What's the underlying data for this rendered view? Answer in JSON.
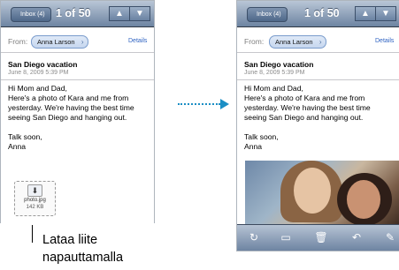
{
  "left_screen": {
    "back_label": "Inbox (4)",
    "title": "1 of 50",
    "up_arrow": "▲",
    "down_arrow": "▼",
    "from_label": "From:",
    "sender": "Anna Larson",
    "details_link": "Details",
    "subject": "San Diego vacation",
    "date": "June 8, 2009 5:39 PM",
    "body_lines": [
      "Hi Mom and Dad,",
      "Here's a photo of Kara and me from",
      "yesterday. We're having the best time",
      "seeing San Diego and hanging out.",
      "",
      "Talk soon,",
      "Anna"
    ],
    "attachment": {
      "name": "photo.jpg",
      "size": "142 KB",
      "icon": "download-arrow-icon"
    }
  },
  "right_screen": {
    "back_label": "Inbox (4)",
    "title": "1 of 50",
    "up_arrow": "▲",
    "down_arrow": "▼",
    "from_label": "From:",
    "sender": "Anna Larson",
    "details_link": "Details",
    "subject": "San Diego vacation",
    "date": "June 8, 2009 5:39 PM",
    "body_lines": [
      "Hi Mom and Dad,",
      "Here's a photo of Kara and me from",
      "yesterday. We're having the best time",
      "seeing San Diego and hanging out.",
      "",
      "Talk soon,",
      "Anna"
    ],
    "toolbar": [
      {
        "icon": "refresh-icon",
        "glyph": "↻"
      },
      {
        "icon": "move-folder-icon",
        "glyph": "▭"
      },
      {
        "icon": "trash-icon",
        "glyph": "🗑"
      },
      {
        "icon": "reply-icon",
        "glyph": "↶"
      },
      {
        "icon": "compose-icon",
        "glyph": "✎"
      }
    ]
  },
  "caption": {
    "line1": "Lataa liite",
    "line2": "napauttamalla"
  },
  "colors": {
    "nav_bar": "#6d84a2",
    "link": "#2f63c2",
    "arrow": "#1b8ec4"
  }
}
